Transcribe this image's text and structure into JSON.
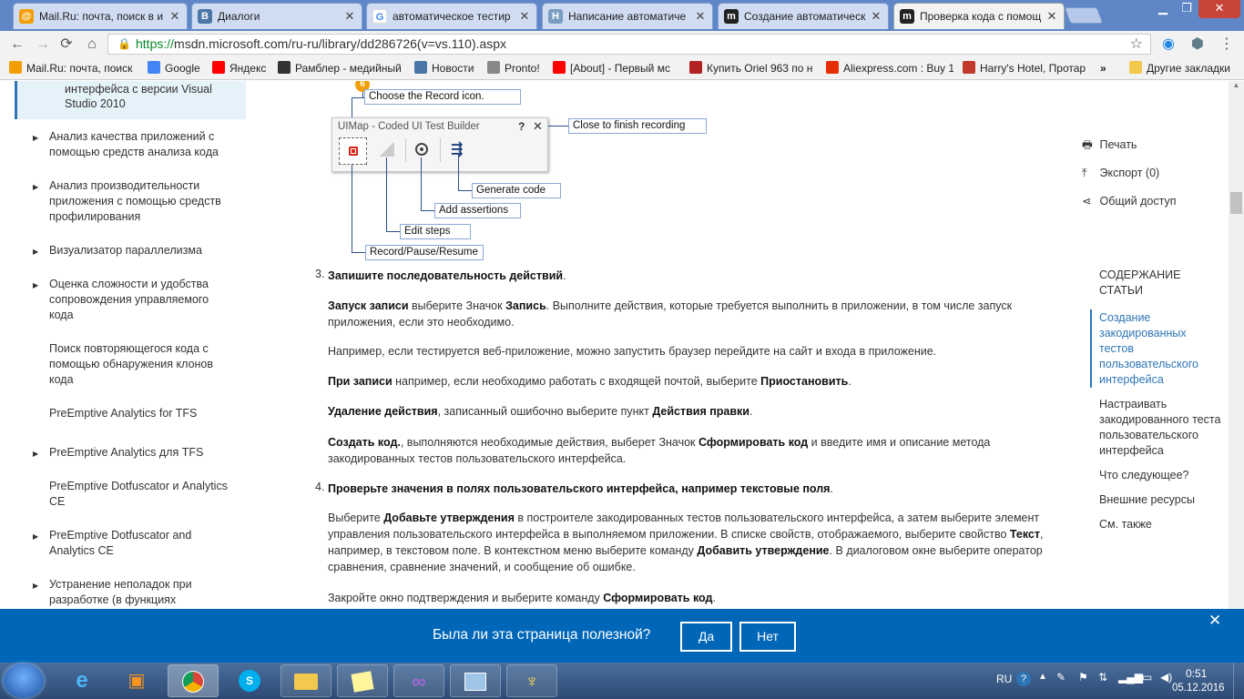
{
  "browser": {
    "tabs": [
      {
        "title": "Mail.Ru: почта, поиск в и",
        "icon": "mailru-icon",
        "color": "#f29f05"
      },
      {
        "title": "Диалоги",
        "icon": "vk-icon",
        "color": "#4a76a8"
      },
      {
        "title": "автоматическое тестир",
        "icon": "google-icon",
        "color": "#ffffff"
      },
      {
        "title": "Написание автоматиче",
        "icon": "habr-icon",
        "color": "#7a9ec2"
      },
      {
        "title": "Создание автоматическ",
        "icon": "msdn-icon",
        "color": "#222222"
      },
      {
        "title": "Проверка кода с помощ",
        "icon": "msdn-icon",
        "color": "#222222"
      }
    ],
    "url_scheme": "https://",
    "url_rest": "msdn.microsoft.com/ru-ru/library/dd286726(v=vs.110).aspx",
    "bookmarks": [
      {
        "label": "Mail.Ru: почта, поиск",
        "color": "#f29f05"
      },
      {
        "label": "Google",
        "color": "#4285f4"
      },
      {
        "label": "Яндекс",
        "color": "#ff0000"
      },
      {
        "label": "Рамблер - медийный",
        "color": "#333333"
      },
      {
        "label": "Новости",
        "color": "#4a76a8"
      },
      {
        "label": "Pronto!",
        "color": "#888888"
      },
      {
        "label": "[About] - Первый мс",
        "color": "#ff0000"
      },
      {
        "label": "Купить Oriel 963 по н",
        "color": "#b22222"
      },
      {
        "label": "Aliexpress.com : Buy 1",
        "color": "#e62e04"
      },
      {
        "label": "Harry's Hotel, Протар",
        "color": "#c0392b"
      }
    ],
    "bookmarks_more": "»",
    "other_bookmarks": "Другие закладки"
  },
  "leftnav": {
    "selected": "интерфейса с версии Visual Studio 2010",
    "items": [
      {
        "label": "Анализ качества приложений с помощью средств анализа кода",
        "arrow": true
      },
      {
        "label": "Анализ производительности приложения с помощью средств профилирования",
        "arrow": true
      },
      {
        "label": "Визуализатор параллелизма",
        "arrow": true
      },
      {
        "label": "Оценка сложности и удобства сопровождения управляемого кода",
        "arrow": true
      },
      {
        "label": "Поиск повторяющегося кода с помощью обнаружения клонов кода",
        "arrow": false
      },
      {
        "label": "PreEmptive Analytics for TFS",
        "arrow": false
      },
      {
        "label": "PreEmptive Analytics для TFS",
        "arrow": true
      },
      {
        "label": "PreEmptive Dotfuscator и Analytics CE",
        "arrow": false
      },
      {
        "label": "PreEmptive Dotfuscator and Analytics CE",
        "arrow": true
      },
      {
        "label": "Устранение неполадок при разработке (в функциях",
        "arrow": true
      }
    ]
  },
  "diagram": {
    "badge": "6",
    "choose_record": "Choose the Record icon.",
    "window_title": "UIMap - Coded UI Test Builder",
    "help": "?",
    "close": "✕",
    "close_label": "Close to finish recording",
    "generate_code": "Generate code",
    "add_assertions": "Add assertions",
    "edit_steps": "Edit steps",
    "record_pause": "Record/Pause/Resume"
  },
  "article": {
    "step3_num": "3.",
    "step3_title": "Запишите последовательность действий",
    "p1_b1": "Запуск записи",
    "p1_t1": " выберите Значок ",
    "p1_b2": "Запись",
    "p1_t2": ". Выполните действия, которые требуется выполнить в приложении, в том числе запуск приложения, если это необходимо.",
    "p2": "Например, если тестируется веб-приложение, можно запустить браузер перейдите на сайт и входа в приложение.",
    "p3_b1": "При записи",
    "p3_t1": " например, если необходимо работать с входящей почтой, выберите ",
    "p3_b2": "Приостановить",
    "p4_b1": "Удаление действия",
    "p4_t1": ", записанный ошибочно выберите пункт ",
    "p4_b2": "Действия правки",
    "p5_b1": "Создать код.",
    "p5_t1": ", выполняются необходимые действия, выберет Значок ",
    "p5_b2": "Сформировать код",
    "p5_t2": " и введите имя и описание метода закодированных тестов пользовательского интерфейса.",
    "step4_num": "4.",
    "step4_title": "Проверьте значения в полях пользовательского интерфейса, например текстовые поля",
    "p6_t1": "Выберите ",
    "p6_b1": "Добавьте утверждения",
    "p6_t2": " в построителе закодированных тестов пользовательского интерфейса, а затем выберите элемент управления пользовательского интерфейса в выполняемом приложении. В списке свойств, отображаемого, выберите свойство ",
    "p6_b2": "Текст",
    "p6_t3": ", например, в текстовом поле. В контекстном меню выберите команду ",
    "p6_b3": "Добавить утверждение",
    "p6_t4": ". В диалоговом окне выберите оператор сравнения, сравнение значений, и сообщение об ошибке.",
    "p7_t1": "Закройте окно подтверждения и выберите команду ",
    "p7_b1": "Сформировать код"
  },
  "rightrail": {
    "print": "Печать",
    "export": "Экспорт (0)",
    "share": "Общий доступ",
    "toc_title": "СОДЕРЖАНИЕ СТАТЬИ",
    "toc": [
      "Создание закодированных тестов пользовательского интерфейса",
      "Настраивать закодированного теста пользовательского интерфейса",
      "Что следующее?",
      "Внешние ресурсы",
      "См. также"
    ]
  },
  "feedback": {
    "question": "Была ли эта страница полезной?",
    "yes": "Да",
    "no": "Нет",
    "close": "✕",
    "bg": "#0067b8"
  },
  "taskbar": {
    "lang": "RU",
    "time": "0:51",
    "date": "05.12.2016"
  }
}
